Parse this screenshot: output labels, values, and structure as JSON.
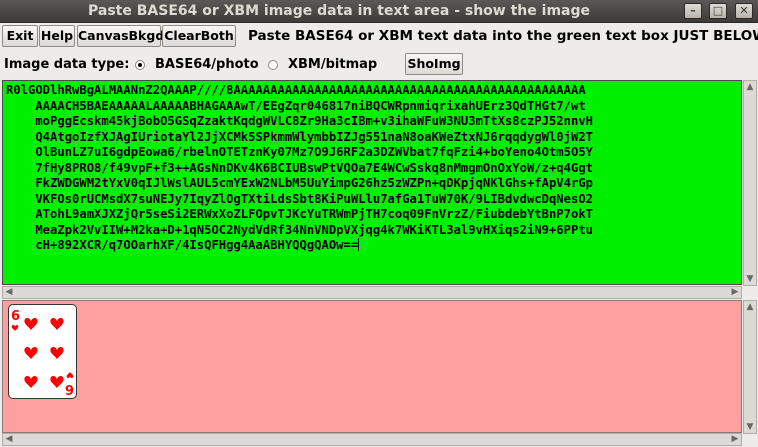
{
  "window": {
    "title": "Paste BASE64 or XBM image data in text area - show the image",
    "controls": {
      "minimize": "–",
      "maximize": "□",
      "close": "✕"
    }
  },
  "toolbar": {
    "exit": "Exit",
    "help": "Help",
    "canvas_bkgd": "CanvasBkgd",
    "clear_both": "ClearBoth",
    "message": "Paste BASE64 or XBM text data into the green text box JUST BELOW."
  },
  "options": {
    "label": "Image data type:",
    "radio_base64": "BASE64/photo",
    "radio_xbm": "XBM/bitmap",
    "selected": "BASE64/photo",
    "show_button": "ShoImg"
  },
  "text_area": {
    "content": "R0lGODlhRwBgALMAANnZ2QAAAP////8AAAAAAAAAAAAAAAAAAAAAAAAAAAAAAAAAAAAAAAAAAAAAAAA\n    AAAACH5BAEAAAAALAAAAABHAGAAAwT/EEgZqr046817niBQCWRpnmiqrixahUErz3QdTHGt7/wt\n    moPggEcskm45kjBobO5GSqZzaktKqdgWVLC8Zr9Ha3cIBm+v3ihaWFuW3NU3mTtXs8czPJ52nnvH\n    Q4AtgoIzfXJAgIUriotaYl2JjXCMk5SPkmmWlymbbIZJg551naN8oaKWeZtxNJ6rqqdygWl0jW2T\n    OlBunLZ7uI6gdpEowa6/rbelnOTETznKy07Mz7O9J6RF2a3DZWVbat7fqFzi4+boYeno4Otm5O5Y\n    7fHy8PRO8/f49vpF+f3++AGsNnDKv4K6BCIUBswPtVQOa7E4WCwSskq8nMmgmOnOxYoW/z+q4Ggt\n    FkZWDGWM2tYxV0qIJlWslAUL5cmYExW2NLbM5UuYimpG26hz5zWZPn+qDKpjqNKlGhs+fApV4rGp\n    VKFOs0rUCMsdX7suNEJy7IqyZlOgTXtiLdsSbt8KiPuWLlu7afGa1TuW70K/9LIBdvdwcDqNesO2\n    ATohL9amXJXZjQr5seSi2ERWxXoZLFOpvTJKcYuTRWmPjTH7coq09FnVrzZ/FiubdebYtBnP7okT\n    MeaZpk2VvIIW+M2ka+D+1qN5OC2NydVdRf34NnVNDpVXjqg4k7WKiKTL3al9vHXiqs2iN9+6PPtu\n    cH+892XCR/q7OOarhXF/4IsQFHgg4AaABHYQQgQAOw==",
    "cursor_visible": true
  },
  "canvas": {
    "background": "#ffa0a0",
    "card": {
      "rank": "6",
      "suit": "hearts",
      "rank_bottom": "9",
      "suit_color": "#ff0000",
      "icon": "heart-icon"
    }
  },
  "colors": {
    "text_area_bg": "#00f000",
    "canvas_bg": "#ffa0a0",
    "titlebar_bg": "#3c3b37"
  }
}
